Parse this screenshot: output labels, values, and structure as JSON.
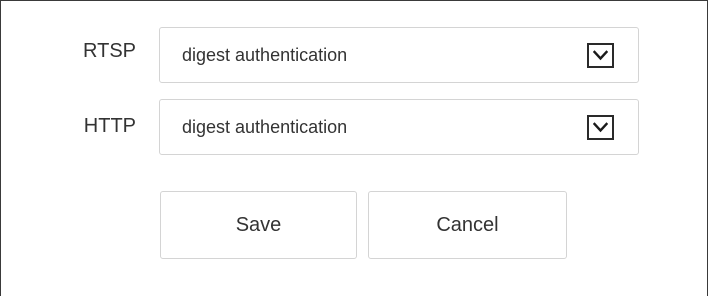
{
  "auth_settings": {
    "rtsp": {
      "label": "RTSP",
      "value": "digest authentication"
    },
    "http": {
      "label": "HTTP",
      "value": "digest authentication"
    }
  },
  "actions": {
    "save_label": "Save",
    "cancel_label": "Cancel"
  },
  "icons": {
    "dropdown": "chevron-down-icon"
  }
}
